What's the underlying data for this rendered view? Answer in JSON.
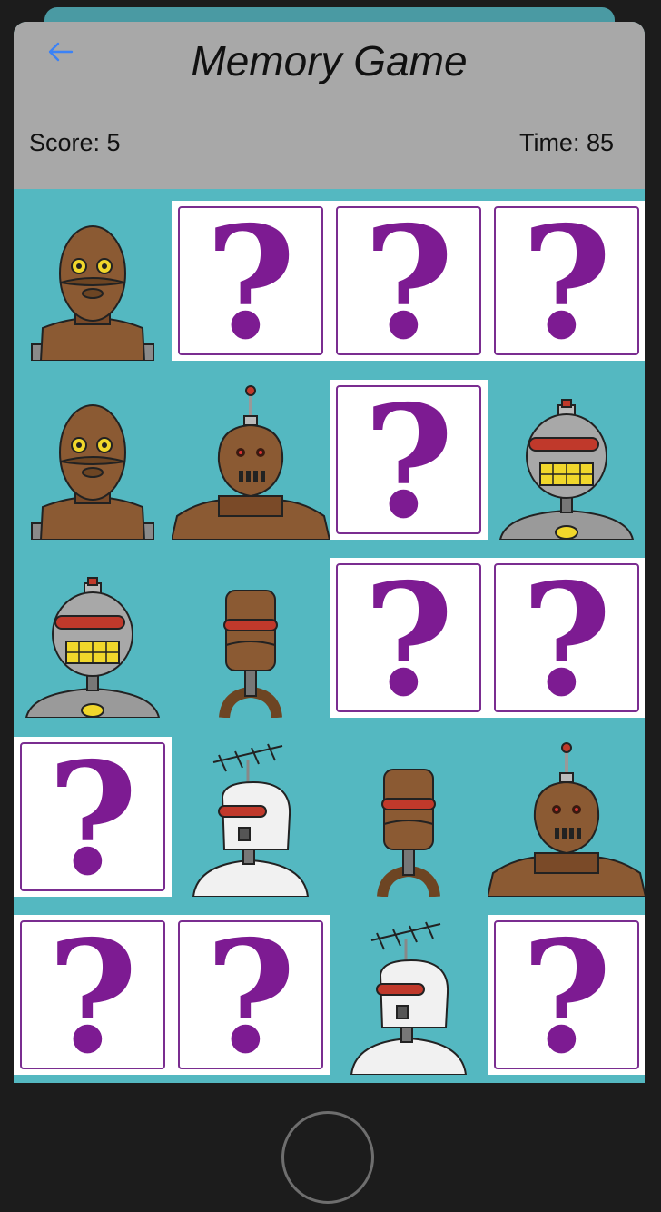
{
  "header": {
    "title": "Memory Game",
    "score_text": "Score: 5",
    "time_text": "Time: 85",
    "back_icon": "back-arrow-icon"
  },
  "colors": {
    "board": "#54b8c1",
    "header": "#a8a8a8",
    "question_mark": "#7d1b92",
    "card_border": "#7a2d90",
    "accent": "#3b82f6"
  },
  "board": {
    "columns": 4,
    "rows": 5,
    "hidden_symbol": "?",
    "cards": [
      {
        "state": "revealed",
        "robot": "brown-robot"
      },
      {
        "state": "hidden",
        "label": "?"
      },
      {
        "state": "hidden",
        "label": "?"
      },
      {
        "state": "hidden",
        "label": "?"
      },
      {
        "state": "revealed",
        "robot": "brown-robot"
      },
      {
        "state": "revealed",
        "robot": "antenna-robot"
      },
      {
        "state": "hidden",
        "label": "?"
      },
      {
        "state": "revealed",
        "robot": "grey-grin-robot"
      },
      {
        "state": "revealed",
        "robot": "grey-grin-robot"
      },
      {
        "state": "revealed",
        "robot": "tall-brown-robot"
      },
      {
        "state": "hidden",
        "label": "?"
      },
      {
        "state": "hidden",
        "label": "?"
      },
      {
        "state": "hidden",
        "label": "?"
      },
      {
        "state": "revealed",
        "robot": "white-tv-robot"
      },
      {
        "state": "revealed",
        "robot": "tall-brown-robot"
      },
      {
        "state": "revealed",
        "robot": "antenna-robot"
      },
      {
        "state": "hidden",
        "label": "?"
      },
      {
        "state": "hidden",
        "label": "?"
      },
      {
        "state": "revealed",
        "robot": "white-tv-robot"
      },
      {
        "state": "hidden",
        "label": "?"
      }
    ]
  },
  "home_button": {
    "icon": "home-button-icon"
  }
}
